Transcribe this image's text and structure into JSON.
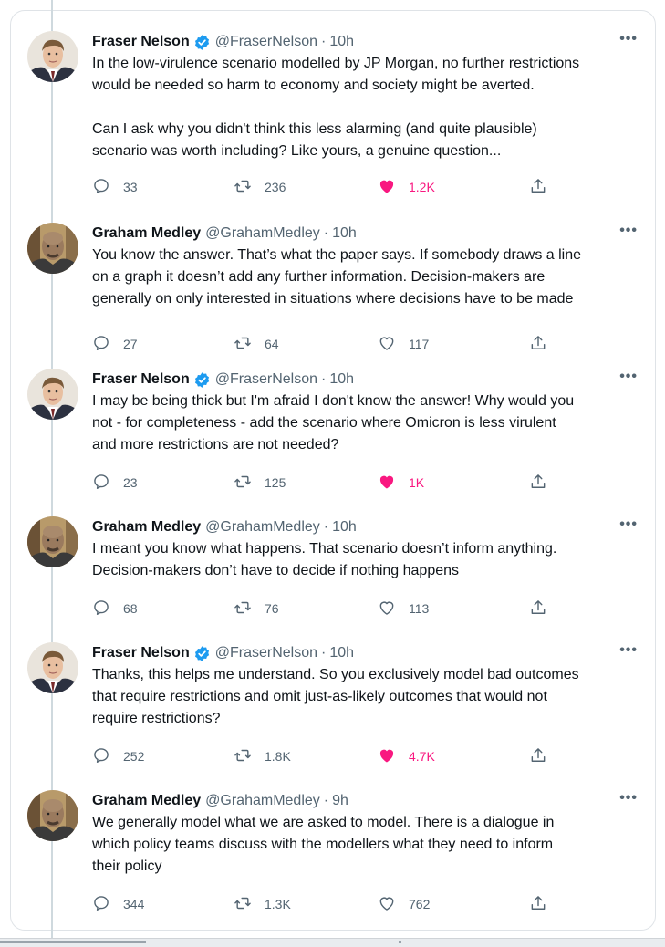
{
  "tweets": [
    {
      "author": "fraser",
      "name": "Fraser Nelson",
      "verified": true,
      "handle": "@FraserNelson",
      "time": "10h",
      "text": "In the low-virulence scenario modelled by JP Morgan, no further restrictions\nwould be needed so harm to economy and society might be averted.\n\nCan I ask why you didn't think this less alarming (and quite plausible)\nscenario was worth including? Like yours, a genuine question...",
      "replies": "33",
      "retweets": "236",
      "likes": "1.2K",
      "liked": true
    },
    {
      "author": "graham",
      "name": "Graham Medley",
      "verified": false,
      "handle": "@GrahamMedley",
      "time": "10h",
      "text": "You know the answer. That’s what the paper says. If somebody draws a line\non a graph it doesn’t add any further information. Decision-makers are\ngenerally on only interested in situations where decisions have to be made",
      "replies": "27",
      "retweets": "64",
      "likes": "117",
      "liked": false
    },
    {
      "author": "fraser",
      "name": "Fraser Nelson",
      "verified": true,
      "handle": "@FraserNelson",
      "time": "10h",
      "text": "I may be being thick but I'm afraid I don't know the answer! Why would you\nnot - for completeness - add the scenario where Omicron is less virulent\nand more restrictions are not needed?",
      "replies": "23",
      "retweets": "125",
      "likes": "1K",
      "liked": true
    },
    {
      "author": "graham",
      "name": "Graham Medley",
      "verified": false,
      "handle": "@GrahamMedley",
      "time": "10h",
      "text": "I meant you know what happens. That scenario doesn’t inform anything.\nDecision-makers don’t have to decide if nothing happens",
      "replies": "68",
      "retweets": "76",
      "likes": "113",
      "liked": false
    },
    {
      "author": "fraser",
      "name": "Fraser Nelson",
      "verified": true,
      "handle": "@FraserNelson",
      "time": "10h",
      "text": "Thanks, this helps me understand. So you exclusively model bad outcomes\nthat require restrictions and omit just-as-likely outcomes that would not\nrequire restrictions?",
      "replies": "252",
      "retweets": "1.8K",
      "likes": "4.7K",
      "liked": true
    },
    {
      "author": "graham",
      "name": "Graham Medley",
      "verified": false,
      "handle": "@GrahamMedley",
      "time": "9h",
      "text": "We generally model what we are asked to model. There is a dialogue in\nwhich policy teams discuss with the modellers what they need to inform\ntheir policy",
      "replies": "344",
      "retweets": "1.3K",
      "likes": "762",
      "liked": false
    }
  ],
  "ui": {
    "more_label": "•••",
    "separator": "·"
  },
  "colors": {
    "like_active": "#f91880",
    "verified": "#1d9bf0",
    "muted": "#536471",
    "thread_line": "#cfd9de"
  },
  "icons": {
    "reply": "reply-icon",
    "retweet": "retweet-icon",
    "like": "heart-icon",
    "share": "share-icon",
    "verified": "verified-badge-icon",
    "more": "more-icon"
  }
}
